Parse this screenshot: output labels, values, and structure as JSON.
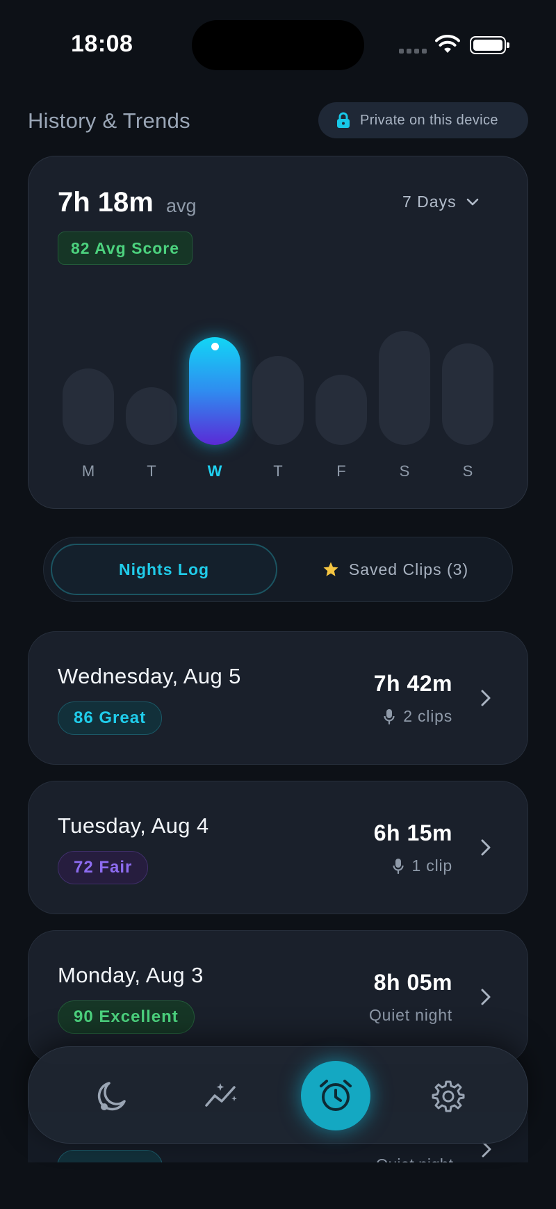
{
  "status_bar": {
    "time": "18:08"
  },
  "header": {
    "title": "History & Trends",
    "privacy_label": "Private on this device"
  },
  "summary": {
    "avg_value": "7h 18m",
    "avg_unit": "avg",
    "range_label": "7 Days",
    "score_badge": "82 Avg Score"
  },
  "chart_data": {
    "type": "bar",
    "categories": [
      "M",
      "T",
      "W",
      "T",
      "F",
      "S",
      "S"
    ],
    "values": [
      6.1,
      4.6,
      8.6,
      7.1,
      5.6,
      9.1,
      8.1
    ],
    "highlighted_index": 2,
    "title": "",
    "xlabel": "",
    "ylabel": "",
    "grid": false
  },
  "segmented": {
    "active_label": "Nights Log",
    "inactive_label": "Saved Clips (3)"
  },
  "nights": [
    {
      "date": "Wednesday, Aug 5",
      "badge": "86 Great",
      "badge_type": "great",
      "duration": "7h 42m",
      "sub": "2 clips",
      "sub_icon": "microphone-icon"
    },
    {
      "date": "Tuesday, Aug 4",
      "badge": "72 Fair",
      "badge_type": "fair",
      "duration": "6h 15m",
      "sub": "1 clip",
      "sub_icon": "microphone-icon"
    },
    {
      "date": "Monday, Aug 3",
      "badge": "90 Excellent",
      "badge_type": "excellent",
      "duration": "8h 05m",
      "sub": "Quiet night",
      "sub_icon": ""
    }
  ],
  "peek": {
    "sub": "Quiet night"
  },
  "tabbar": {
    "items": [
      {
        "icon": "moon-icon",
        "active": false
      },
      {
        "icon": "trends-icon",
        "active": false
      },
      {
        "icon": "alarm-clock-icon",
        "active": true
      },
      {
        "icon": "gear-icon",
        "active": false
      }
    ]
  },
  "colors": {
    "background": "#0d1117",
    "card": "#1a202b",
    "accent_cyan": "#20ccea",
    "accent_purple": "#8d6cf0",
    "accent_green": "#4cd27e"
  }
}
